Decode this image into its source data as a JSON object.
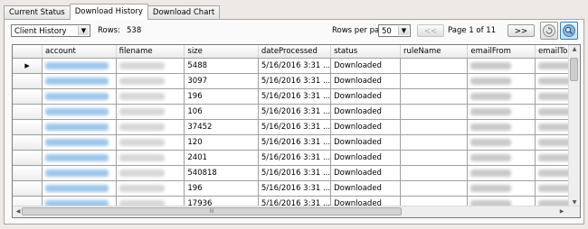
{
  "tabs": [
    {
      "label": "Current Status",
      "active": false
    },
    {
      "label": "Download History",
      "active": true
    },
    {
      "label": "Download Chart",
      "active": false
    }
  ],
  "toolbar": {
    "history_select": "Client History",
    "rows_label": "Rows:",
    "rows_count": "538",
    "rows_per_page_label": "Rows per page",
    "rows_per_page_value": "50",
    "prev_label": "<<",
    "page_info": "Page 1 of 11",
    "next_label": ">>",
    "refresh_icon": "refresh-icon",
    "search_icon": "search-icon"
  },
  "grid": {
    "columns": [
      "account",
      "filename",
      "size",
      "dateProcessed",
      "status",
      "ruleName",
      "emailFrom",
      "emailTo"
    ],
    "rows": [
      {
        "size": "5488",
        "dateProcessed": "5/16/2016 3:31 ...",
        "status": "Downloaded",
        "current": true
      },
      {
        "size": "3097",
        "dateProcessed": "5/16/2016 3:31 ...",
        "status": "Downloaded",
        "current": false
      },
      {
        "size": "196",
        "dateProcessed": "5/16/2016 3:31 ...",
        "status": "Downloaded",
        "current": false
      },
      {
        "size": "106",
        "dateProcessed": "5/16/2016 3:31 ...",
        "status": "Downloaded",
        "current": false
      },
      {
        "size": "37452",
        "dateProcessed": "5/16/2016 3:31 ...",
        "status": "Downloaded",
        "current": false
      },
      {
        "size": "120",
        "dateProcessed": "5/16/2016 3:31 ...",
        "status": "Downloaded",
        "current": false
      },
      {
        "size": "2401",
        "dateProcessed": "5/16/2016 3:31 ...",
        "status": "Downloaded",
        "current": false
      },
      {
        "size": "540818",
        "dateProcessed": "5/16/2016 3:31 ...",
        "status": "Downloaded",
        "current": false
      },
      {
        "size": "196",
        "dateProcessed": "5/16/2016 3:31 ...",
        "status": "Downloaded",
        "current": false
      },
      {
        "size": "17936",
        "dateProcessed": "5/16/2016 3:31 ...",
        "status": "Downloaded",
        "current": false
      }
    ],
    "current_row_marker": "▶",
    "scroll_grip": "III"
  }
}
